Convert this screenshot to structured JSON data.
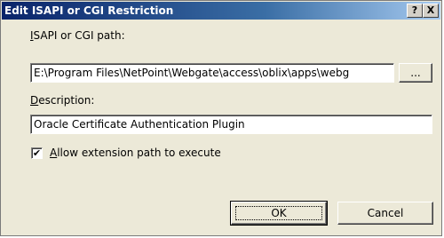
{
  "window": {
    "title": "Edit ISAPI or CGI Restriction",
    "help_label": "?",
    "close_label": "X"
  },
  "isapi": {
    "label_first": "I",
    "label_rest": "SAPI or CGI path:",
    "value": "E:\\Program Files\\NetPoint\\Webgate\\access\\oblix\\apps\\webg",
    "browse_label": "..."
  },
  "description": {
    "label_first": "D",
    "label_rest": "escription:",
    "value": "Oracle Certificate Authentication Plugin"
  },
  "allow": {
    "checked": true,
    "check_glyph": "✔",
    "label_first": "A",
    "label_rest": "llow extension path to execute"
  },
  "buttons": {
    "ok_label": "OK",
    "cancel_label": "Cancel"
  }
}
